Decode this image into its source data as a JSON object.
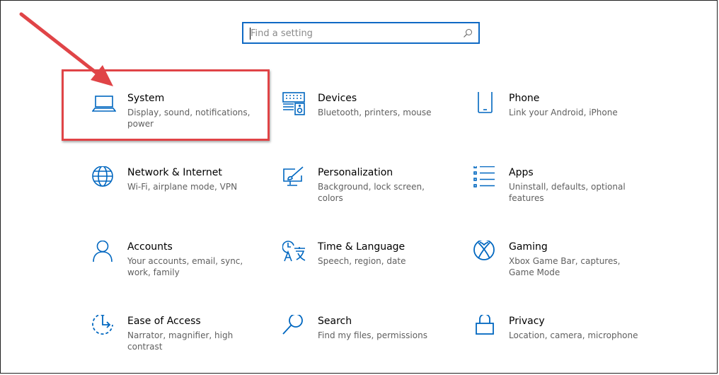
{
  "search": {
    "placeholder": "Find a setting",
    "icon": "search-icon"
  },
  "accent_color": "#0067c0",
  "annotation_color": "#e04447",
  "tiles": [
    {
      "title": "System",
      "description": "Display, sound, notifications, power",
      "icon": "laptop-icon"
    },
    {
      "title": "Devices",
      "description": "Bluetooth, printers, mouse",
      "icon": "keyboard-speaker-icon"
    },
    {
      "title": "Phone",
      "description": "Link your Android, iPhone",
      "icon": "phone-icon"
    },
    {
      "title": "Network & Internet",
      "description": "Wi-Fi, airplane mode, VPN",
      "icon": "globe-icon"
    },
    {
      "title": "Personalization",
      "description": "Background, lock screen, colors",
      "icon": "paintbrush-monitor-icon"
    },
    {
      "title": "Apps",
      "description": "Uninstall, defaults, optional features",
      "icon": "apps-list-icon"
    },
    {
      "title": "Accounts",
      "description": "Your accounts, email, sync, work, family",
      "icon": "person-icon"
    },
    {
      "title": "Time & Language",
      "description": "Speech, region, date",
      "icon": "time-language-icon"
    },
    {
      "title": "Gaming",
      "description": "Xbox Game Bar, captures, Game Mode",
      "icon": "xbox-icon"
    },
    {
      "title": "Ease of Access",
      "description": "Narrator, magnifier, high contrast",
      "icon": "ease-of-access-icon"
    },
    {
      "title": "Search",
      "description": "Find my files, permissions",
      "icon": "magnifier-icon"
    },
    {
      "title": "Privacy",
      "description": "Location, camera, microphone",
      "icon": "lock-icon"
    }
  ]
}
